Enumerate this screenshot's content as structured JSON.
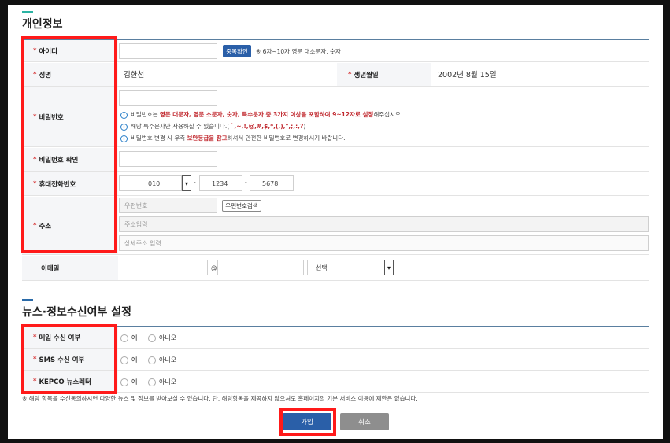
{
  "personal": {
    "title": "개인정보",
    "userid": {
      "label": "아이디",
      "dup_button": "중복확인",
      "hint": "※ 6자~10자 영문 대소문자, 숫자"
    },
    "name": {
      "label": "성명",
      "value": "김한천"
    },
    "birth": {
      "label": "생년월일",
      "value": "2002년 8월 15일"
    },
    "password": {
      "label": "비밀번호",
      "notes": [
        {
          "pre": "비밀번호는 ",
          "red": "영문 대문자, 영문 소문자, 숫자, 특수문자 중 3가지 이상을 포함하여 9~12자로 설정",
          "post": "해주십시오."
        },
        {
          "pre": "해당 특수문자만 사용하실 수 있습니다.( ",
          "red": "`,~,!,@,#,$,*,(,),\",;,:,?",
          "post": ")"
        },
        {
          "pre": "비밀번호 변경 시 우측 ",
          "red": "보안등급을 참고",
          "post": "하셔서 안전한 비밀번호로 변경하시기 바랍니다."
        }
      ]
    },
    "password_confirm": {
      "label": "비밀번호 확인"
    },
    "phone": {
      "label": "휴대전화번호",
      "prefix": "010",
      "mid": "1234",
      "last": "5678",
      "dash": "-"
    },
    "address": {
      "label": "주소",
      "postcode_placeholder": "우편번호",
      "search_button": "우편번호검색",
      "addr_placeholder": "주소입력",
      "detail_placeholder": "상세주소 입력"
    },
    "email": {
      "label": "이메일",
      "at": "@",
      "domain_select": "선택"
    }
  },
  "news": {
    "title": "뉴스·정보수신여부 설정",
    "rows": [
      {
        "label": "메일 수신 여부",
        "yes": "예",
        "no": "아니오"
      },
      {
        "label": "SMS 수신 여부",
        "yes": "예",
        "no": "아니오"
      },
      {
        "label": "KEPCO 뉴스레터",
        "yes": "예",
        "no": "아니오"
      }
    ],
    "footnote": "※ 해당 항목을 수신동의하시면 다양한 뉴스 및 정보를 받아보실 수 있습니다. 단, 해당항목을 제공하지 않으셔도 홈페이지의 기본 서비스 이용에 제한은 없습니다."
  },
  "actions": {
    "join": "가입",
    "cancel": "취소"
  },
  "required_mark": "*",
  "colors": {
    "primary": "#2a5fa8",
    "highlight": "#ff1a1a",
    "note_red": "#c0272d"
  }
}
